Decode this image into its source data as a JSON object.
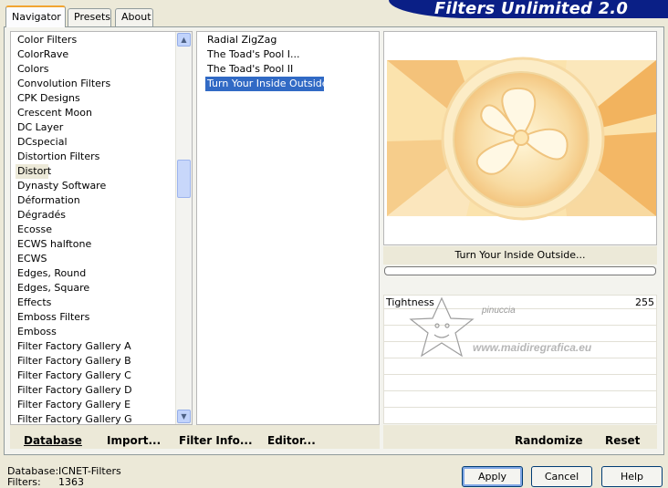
{
  "tabs": [
    {
      "label": "Navigator",
      "active": true
    },
    {
      "label": "Presets",
      "active": false
    },
    {
      "label": "About",
      "active": false
    }
  ],
  "banner_title": "Filters Unlimited 2.0",
  "categories": [
    "Color Filters",
    "ColorRave",
    "Colors",
    "Convolution Filters",
    "CPK Designs",
    "Crescent Moon",
    "DC Layer",
    "DCspecial",
    "Distortion Filters",
    "Distort",
    "Dynasty Software",
    "Déformation",
    "Dégradés",
    "Ecosse",
    "ECWS halftone",
    "ECWS",
    "Edges, Round",
    "Edges, Square",
    "Effects",
    "Emboss Filters",
    "Emboss",
    "Filter Factory Gallery A",
    "Filter Factory Gallery B",
    "Filter Factory Gallery C",
    "Filter Factory Gallery D",
    "Filter Factory Gallery E",
    "Filter Factory Gallery G"
  ],
  "current_category": "Distort",
  "filters": [
    "Radial ZigZag",
    "The Toad's Pool I...",
    "The Toad's Pool II",
    "Turn Your Inside Outside..."
  ],
  "selected_filter": "Turn Your Inside Outside...",
  "preview_filter_name": "Turn Your Inside Outside...",
  "progress": 0,
  "parameters": [
    {
      "name": "Tightness",
      "value": "255"
    }
  ],
  "watermark": {
    "text1": "pinuccia",
    "text2": "www.maidiregrafica.eu"
  },
  "bottom_links": {
    "database": "Database",
    "import": "Import...",
    "filter_info": "Filter Info...",
    "editor": "Editor..."
  },
  "randomize_label": "Randomize",
  "reset_label": "Reset",
  "status": {
    "database_label": "Database:",
    "database_value": "ICNET-Filters",
    "filters_label": "Filters:",
    "filters_value": "1363"
  },
  "buttons": {
    "apply": "Apply",
    "cancel": "Cancel",
    "help": "Help"
  },
  "colors": {
    "selection": "#316ac5",
    "banner": "#0a1f86",
    "preview_primary": "#f5c97a"
  }
}
